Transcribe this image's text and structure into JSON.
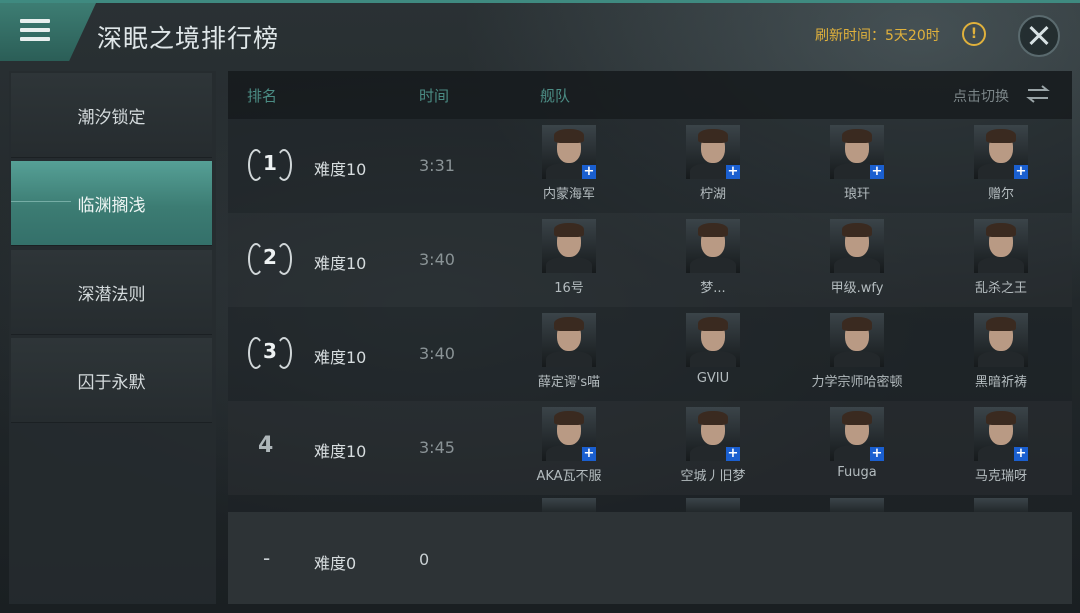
{
  "header": {
    "title": "深眠之境排行榜",
    "refresh_label": "刷新时间：",
    "refresh_value": "5天20时",
    "warn_icon": "!",
    "close_icon": "close-icon"
  },
  "sidebar": {
    "items": [
      {
        "label": "潮汐锁定",
        "active": false
      },
      {
        "label": "临渊搁浅",
        "active": true
      },
      {
        "label": "深潜法则",
        "active": false
      },
      {
        "label": "囚于永默",
        "active": false
      }
    ]
  },
  "table": {
    "headers": {
      "rank": "排名",
      "time": "时间",
      "fleet": "舰队"
    },
    "switch_label": "点击切换",
    "rows": [
      {
        "rank": "1",
        "difficulty": "难度10",
        "time": "3:31",
        "pilots": [
          {
            "name": "内蒙海军",
            "plus": true
          },
          {
            "name": "柠湖",
            "plus": true
          },
          {
            "name": "琅玕",
            "plus": true
          },
          {
            "name": "赠尔",
            "plus": true
          }
        ]
      },
      {
        "rank": "2",
        "difficulty": "难度10",
        "time": "3:40",
        "pilots": [
          {
            "name": "16号",
            "plus": false
          },
          {
            "name": "梦...",
            "plus": false
          },
          {
            "name": "甲级.wfy",
            "plus": false
          },
          {
            "name": "乱杀之王",
            "plus": false
          }
        ]
      },
      {
        "rank": "3",
        "difficulty": "难度10",
        "time": "3:40",
        "pilots": [
          {
            "name": "薛定谔's喵",
            "plus": false
          },
          {
            "name": "GVIU",
            "plus": false
          },
          {
            "name": "力学宗师哈密顿",
            "plus": false
          },
          {
            "name": "黑暗祈祷",
            "plus": false
          }
        ]
      },
      {
        "rank": "4",
        "difficulty": "难度10",
        "time": "3:45",
        "pilots": [
          {
            "name": "AKA瓦不服",
            "plus": true
          },
          {
            "name": "空城丿旧梦",
            "plus": true
          },
          {
            "name": "Fuuga",
            "plus": true
          },
          {
            "name": "马克瑞呀",
            "plus": true
          }
        ]
      }
    ]
  },
  "my_row": {
    "rank": "-",
    "difficulty": "难度0",
    "time": "0"
  }
}
